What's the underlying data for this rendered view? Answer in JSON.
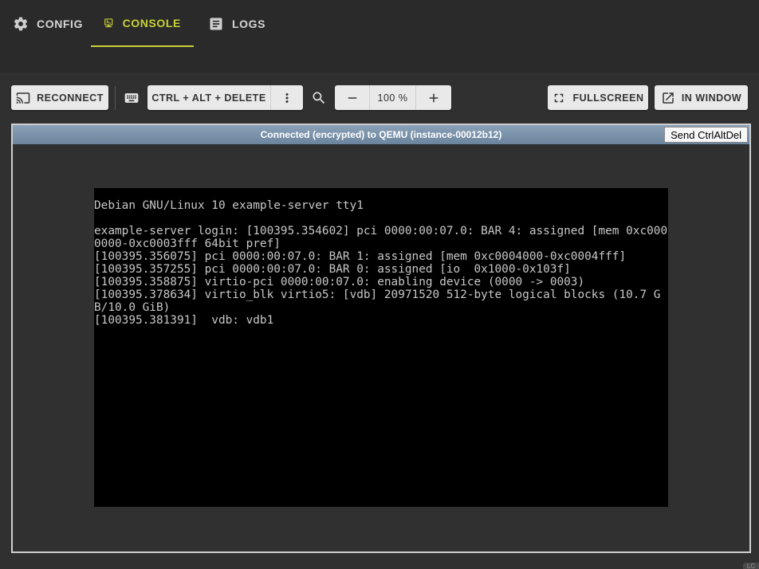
{
  "tabs": [
    {
      "label": "CONFIG",
      "icon": "gear-icon",
      "active": false
    },
    {
      "label": "CONSOLE",
      "icon": "console-icon",
      "active": true
    },
    {
      "label": "LOGS",
      "icon": "document-icon",
      "active": false
    }
  ],
  "toolbar": {
    "reconnect_label": "RECONNECT",
    "ctrl_alt_delete_label": "CTRL + ALT + DELETE",
    "zoom_level": "100 %",
    "fullscreen_label": "FULLSCREEN",
    "in_window_label": "IN WINDOW"
  },
  "vnc": {
    "status": "Connected (encrypted) to QEMU (instance-00012b12)",
    "send_cad_label": "Send CtrlAltDel",
    "console_text": "Debian GNU/Linux 10 example-server tty1\n\nexample-server login: [100395.354602] pci 0000:00:07.0: BAR 4: assigned [mem 0xc0000000-0xc0003fff 64bit pref]\n[100395.356075] pci 0000:00:07.0: BAR 1: assigned [mem 0xc0004000-0xc0004fff]\n[100395.357255] pci 0000:00:07.0: BAR 0: assigned [io  0x1000-0x103f]\n[100395.358875] virtio-pci 0000:00:07.0: enabling device (0000 -> 0003)\n[100395.378634] virtio_blk virtio5: [vdb] 20971520 512-byte logical blocks (10.7 GB/10.0 GiB)\n[100395.381391]  vdb: vdb1"
  },
  "colors": {
    "accent": "#c8d136",
    "background": "#303030",
    "status_bar": "#7b93ab"
  },
  "corner_label": "LC"
}
